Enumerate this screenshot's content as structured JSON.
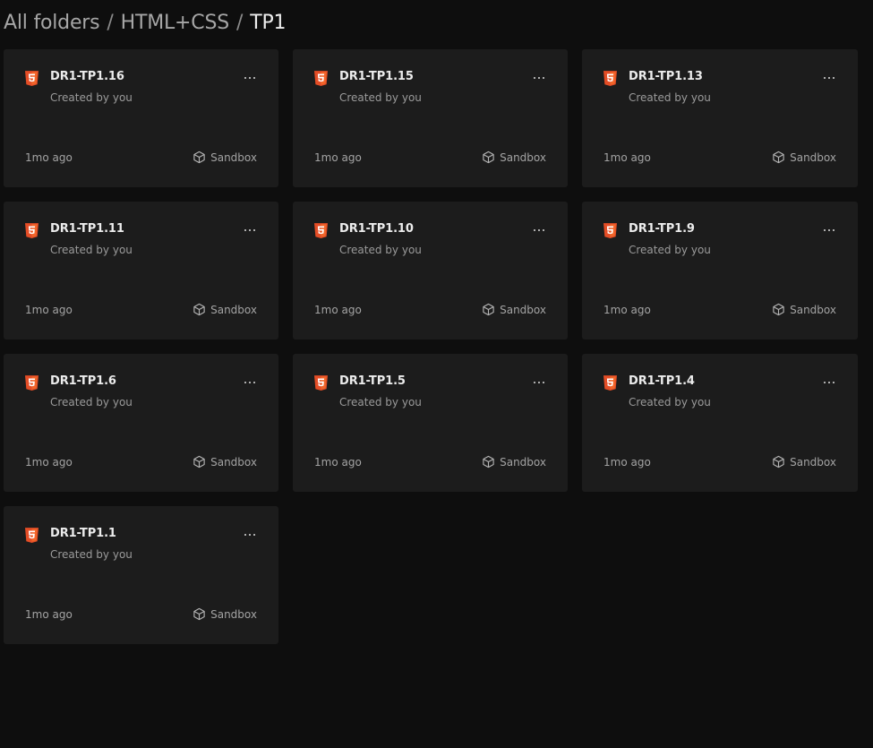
{
  "breadcrumb": {
    "root": "All folders",
    "separator": "/",
    "parent": "HTML+CSS",
    "current": "TP1"
  },
  "colors": {
    "background": "#0e0e0e",
    "card": "#1c1c1c",
    "html5_orange": "#e44d26"
  },
  "cards": [
    {
      "title": "DR1-TP1.16",
      "creator": "Created by you",
      "time": "1mo ago",
      "type": "Sandbox",
      "icon": "html5-icon"
    },
    {
      "title": "DR1-TP1.15",
      "creator": "Created by you",
      "time": "1mo ago",
      "type": "Sandbox",
      "icon": "html5-icon"
    },
    {
      "title": "DR1-TP1.13",
      "creator": "Created by you",
      "time": "1mo ago",
      "type": "Sandbox",
      "icon": "html5-icon"
    },
    {
      "title": "DR1-TP1.11",
      "creator": "Created by you",
      "time": "1mo ago",
      "type": "Sandbox",
      "icon": "html5-icon"
    },
    {
      "title": "DR1-TP1.10",
      "creator": "Created by you",
      "time": "1mo ago",
      "type": "Sandbox",
      "icon": "html5-icon"
    },
    {
      "title": "DR1-TP1.9",
      "creator": "Created by you",
      "time": "1mo ago",
      "type": "Sandbox",
      "icon": "html5-icon"
    },
    {
      "title": "DR1-TP1.6",
      "creator": "Created by you",
      "time": "1mo ago",
      "type": "Sandbox",
      "icon": "html5-icon"
    },
    {
      "title": "DR1-TP1.5",
      "creator": "Created by you",
      "time": "1mo ago",
      "type": "Sandbox",
      "icon": "html5-icon"
    },
    {
      "title": "DR1-TP1.4",
      "creator": "Created by you",
      "time": "1mo ago",
      "type": "Sandbox",
      "icon": "html5-icon"
    },
    {
      "title": "DR1-TP1.1",
      "creator": "Created by you",
      "time": "1mo ago",
      "type": "Sandbox",
      "icon": "html5-icon"
    }
  ]
}
